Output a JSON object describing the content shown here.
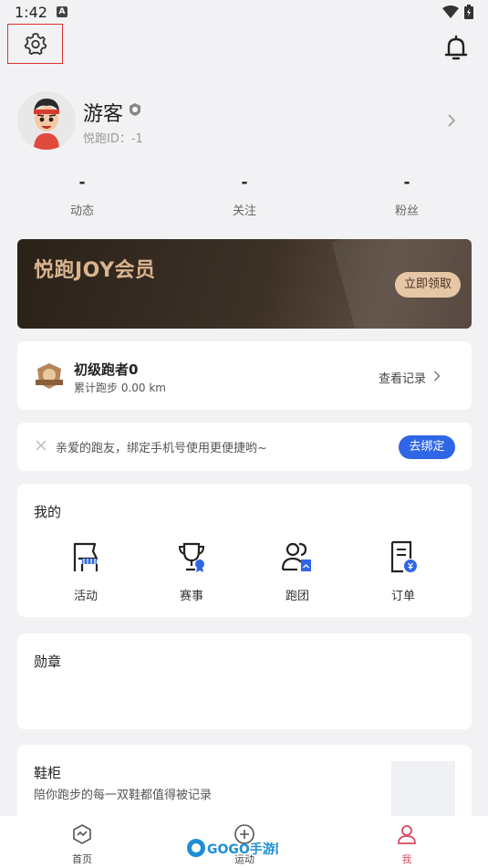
{
  "status_bar": {
    "time": "1:42",
    "indicator": "A"
  },
  "profile": {
    "username": "游客",
    "id_label": "悦跑ID：",
    "id_value": "-1"
  },
  "stats": [
    {
      "value": "-",
      "label": "动态"
    },
    {
      "value": "-",
      "label": "关注"
    },
    {
      "value": "-",
      "label": "粉丝"
    }
  ],
  "membership": {
    "title": "悦跑JOY会员",
    "button": "立即领取"
  },
  "level": {
    "name": "初级跑者0",
    "distance": "累计跑步 0.00 km",
    "records": "查看记录"
  },
  "bind_phone": {
    "text": "亲爱的跑友，绑定手机号使用更便捷哟~",
    "button": "去绑定"
  },
  "mine": {
    "title": "我的",
    "items": [
      {
        "label": "活动",
        "icon": "flag-icon"
      },
      {
        "label": "赛事",
        "icon": "trophy-icon"
      },
      {
        "label": "跑团",
        "icon": "group-icon"
      },
      {
        "label": "订单",
        "icon": "order-icon"
      }
    ]
  },
  "medals": {
    "title": "勋章"
  },
  "shoes": {
    "title": "鞋柜",
    "subtitle": "陪你跑步的每一双鞋都值得被记录"
  },
  "bottom_nav": [
    {
      "label": "首页",
      "icon": "home-icon",
      "active": false
    },
    {
      "label": "运动",
      "icon": "plus-circle-icon",
      "active": false
    },
    {
      "label": "我",
      "icon": "profile-icon",
      "active": true
    }
  ],
  "watermark": "GOGO手游网",
  "colors": {
    "accent": "#2f66e6",
    "nav_active": "#d9485f",
    "banner_gold": "#d9b48e",
    "highlight_box": "#dd3333"
  }
}
